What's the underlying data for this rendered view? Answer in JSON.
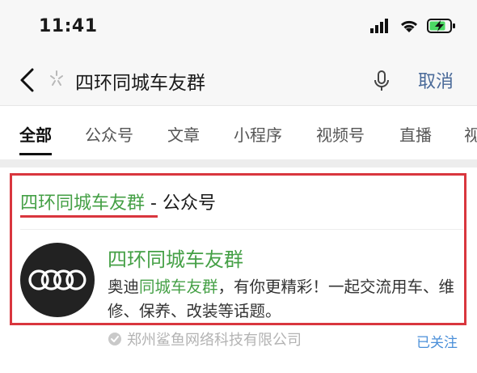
{
  "status_bar": {
    "time": "11:41"
  },
  "search": {
    "query": "四环同城车友群",
    "cancel_label": "取消"
  },
  "tabs": [
    {
      "label": "全部",
      "active": true
    },
    {
      "label": "公众号"
    },
    {
      "label": "文章"
    },
    {
      "label": "小程序"
    },
    {
      "label": "视频号"
    },
    {
      "label": "直播"
    },
    {
      "label": "视"
    }
  ],
  "result": {
    "section_title_highlight": "四环同城车友群",
    "section_title_suffix": " - 公众号",
    "account_name": "四环同城车友群",
    "description_prefix": "奥迪",
    "description_highlight": "同城车友群",
    "description_suffix": "，有你更精彩！一起交流用车、维修、保养、改装等话题。",
    "company": "郑州鲨鱼网络科技有限公司",
    "follow_status": "已关注"
  },
  "colors": {
    "highlight_green": "#45a046",
    "annotation_red": "#d9363e",
    "link_blue": "#4a6a99"
  }
}
